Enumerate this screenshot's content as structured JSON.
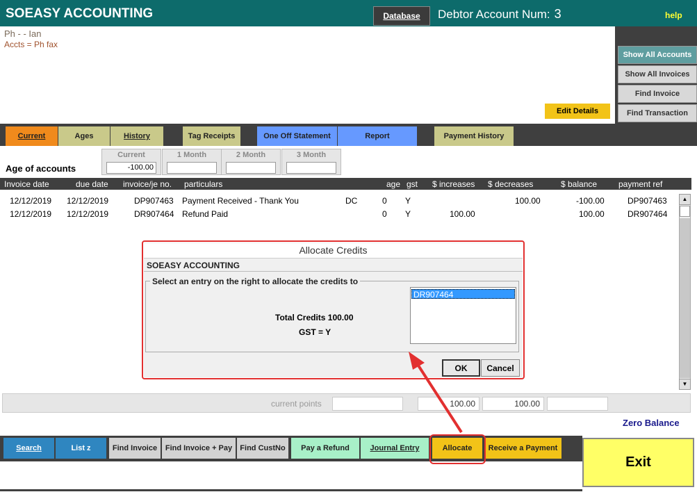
{
  "header": {
    "app_title": "SOEASY ACCOUNTING",
    "database_label": "Database",
    "debtor_label": "Debtor Account Num:",
    "debtor_num": "3",
    "help_label": "help"
  },
  "contact": {
    "line1": "Ph  -  - Ian",
    "line2": "Accts =  Ph  fax"
  },
  "side_panel": {
    "show_all_accounts": "Show All Accounts",
    "show_all_invoices": "Show All Invoices",
    "find_invoice": "Find Invoice",
    "find_transaction": "Find Transaction",
    "edit_details": "Edit Details"
  },
  "tabs": {
    "current": "Current",
    "ages": "Ages",
    "history": "History",
    "tag_receipts": "Tag Receipts",
    "one_off_statement": "One Off Statement",
    "report": "Report",
    "payment_history": "Payment History"
  },
  "ages": {
    "title": "Age of accounts",
    "current_label": "Current",
    "current_value": "-100.00",
    "month1_label": "1 Month",
    "month1_value": "",
    "month2_label": "2 Month",
    "month2_value": "",
    "month3_label": "3 Month",
    "month3_value": ""
  },
  "table": {
    "columns": [
      "Invoice date",
      "due date",
      "invoice/je no.",
      "particulars",
      "age",
      "gst",
      "$ increases",
      "$ decreases",
      "$ balance",
      "payment ref"
    ],
    "rows": [
      {
        "invoice_date": "12/12/2019",
        "due_date": "12/12/2019",
        "invoice_no": "DP907463",
        "particulars": "Payment Received - Thank You",
        "code": "DC",
        "age": "0",
        "gst": "Y",
        "increases": "",
        "decreases": "100.00",
        "balance": "-100.00",
        "payment_ref": "DP907463"
      },
      {
        "invoice_date": "12/12/2019",
        "due_date": "12/12/2019",
        "invoice_no": "DR907464",
        "particulars": "Refund Paid",
        "code": "",
        "age": "0",
        "gst": "Y",
        "increases": "100.00",
        "decreases": "",
        "balance": "100.00",
        "payment_ref": "DR907464"
      }
    ]
  },
  "dialog": {
    "title": "Allocate Credits",
    "company": "SOEASY ACCOUNTING",
    "group_label": "Select an entry on the right to allocate the credits to",
    "total_credits": "Total Credits 100.00",
    "gst": "GST = Y",
    "entries": [
      "DR907464"
    ],
    "ok_label": "OK",
    "cancel_label": "Cancel"
  },
  "totals": {
    "points_label": "current points",
    "points_value": "",
    "increases": "100.00",
    "decreases": "100.00",
    "balance": "",
    "status": "Zero Balance"
  },
  "bottom_buttons": {
    "search": "Search",
    "list": "List z",
    "find_invoice": "Find Invoice",
    "find_invoice_pay": "Find Invoice + Pay",
    "find_custno": "Find CustNo",
    "pay_refund": "Pay a Refund",
    "journal_entry": "Journal Entry",
    "allocate": "Allocate",
    "receive_payment": "Receive a Payment",
    "exit": "Exit"
  },
  "colors": {
    "header_bg": "#0d6b6b",
    "highlight_red": "#e23030",
    "accent_yellow": "#f2c318",
    "selection_blue": "#3399ff"
  }
}
